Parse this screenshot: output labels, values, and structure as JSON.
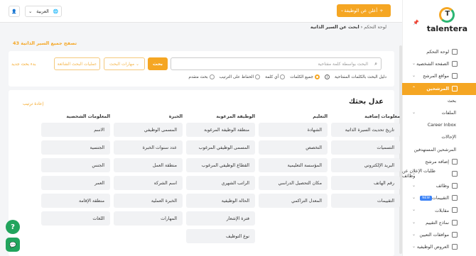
{
  "topbar": {
    "post_job_label": "أعلن عن الوظيفة",
    "post_job_plus": "+",
    "post_job_chevron": "⌄",
    "language": "العربية",
    "language_chevron": "⌄",
    "globe": "🌐",
    "user_icon": "👤"
  },
  "sidebar": {
    "pin": "📌",
    "logo_text": "talentera",
    "items": [
      {
        "label": "لوحة التحكم",
        "type": "main"
      },
      {
        "label": "الصفحة الشخصية",
        "type": "main",
        "caret": "⌄"
      },
      {
        "label": "مواقع المرشح",
        "type": "main",
        "caret": "⌄"
      },
      {
        "label": "المرشحين",
        "type": "active",
        "caret": "⌃"
      },
      {
        "label": "بحث",
        "type": "sub"
      },
      {
        "label": "الملفات",
        "type": "sub",
        "caret": "⌄"
      },
      {
        "label": "Career Inbox",
        "type": "sub"
      },
      {
        "label": "الإحالات",
        "type": "sub"
      },
      {
        "label": "المرشحين المستهدفين",
        "type": "sub"
      },
      {
        "label": "إضافة مرشح",
        "type": "main"
      },
      {
        "label": "طلبات الإعلان عن وظائف",
        "type": "main",
        "caret": "⌄"
      },
      {
        "label": "وظائف",
        "type": "main",
        "caret": "⌄"
      },
      {
        "label": "التقييمات",
        "type": "main",
        "caret": "⌄",
        "badge": "NEW"
      },
      {
        "label": "مقابلات",
        "type": "main",
        "caret": "⌄"
      },
      {
        "label": "نماذج التقييم",
        "type": "main",
        "caret": "⌄"
      },
      {
        "label": "موافقات التعيين",
        "type": "main",
        "caret": "⌄"
      },
      {
        "label": "العروض الوظيفية",
        "type": "main",
        "caret": "⌄"
      }
    ]
  },
  "breadcrumb": {
    "root": "لوحة التحكم",
    "sep": "‹",
    "current": "ابحث عن السير الذاتية"
  },
  "save_all": "تصفح جميع السير الذاتية 43",
  "search": {
    "placeholder": "البحث بواسطة كلمة مفتاحية",
    "search_label": "بحث",
    "skills_label": "مهارات البحث ⌄",
    "ops_label": "عمليات البحث الشائعة",
    "new_search_label": "بدء بحث جديد",
    "keyword_guide": "دليل البحث بالكلمات المفتاحية",
    "options": [
      "جميع الكلمات",
      "أي كلمة",
      "الحفاظ على الترتيب",
      "بحث متقدم"
    ]
  },
  "filters": {
    "title": "عدل بحثك",
    "reset_label": "إعادة ترتيب",
    "columns": [
      {
        "heading": "معلومات إضافية",
        "items": [
          "تاريخ تحديث السيرة الذاتية",
          "التسميات",
          "البريد الإلكتروني",
          "رقم الهاتف",
          "التقييمات"
        ]
      },
      {
        "heading": "التعليم",
        "items": [
          "الشهادة",
          "التخصص",
          "المؤسسة التعليمية",
          "مكان التحصيل الدراسي",
          "المعدل التراكمي"
        ]
      },
      {
        "heading": "الوظيفة المرغوبة",
        "items": [
          "منطقة الوظيفة المرغوبة",
          "المسمى الوظيفي المرغوب",
          "القطاع الوظيفي المرغوب",
          "الراتب الشهري",
          "الحالة الوظيفية",
          "فترة الإشعار",
          "نوع التوظيف"
        ]
      },
      {
        "heading": "الخبرة",
        "items": [
          "المسمى الوظيفي",
          "عدد سنوات الخبرة",
          "منطقة العمل",
          "اسم الشركة",
          "الخبرة العملية",
          "المهارات"
        ]
      },
      {
        "heading": "المعلومات الشخصية",
        "items": [
          "الاسم",
          "الجنسية",
          "الجنس",
          "العمر",
          "منطقة الإقامة",
          "اللغات"
        ]
      }
    ]
  },
  "fab": {
    "help": "?",
    "chat": "💬"
  }
}
